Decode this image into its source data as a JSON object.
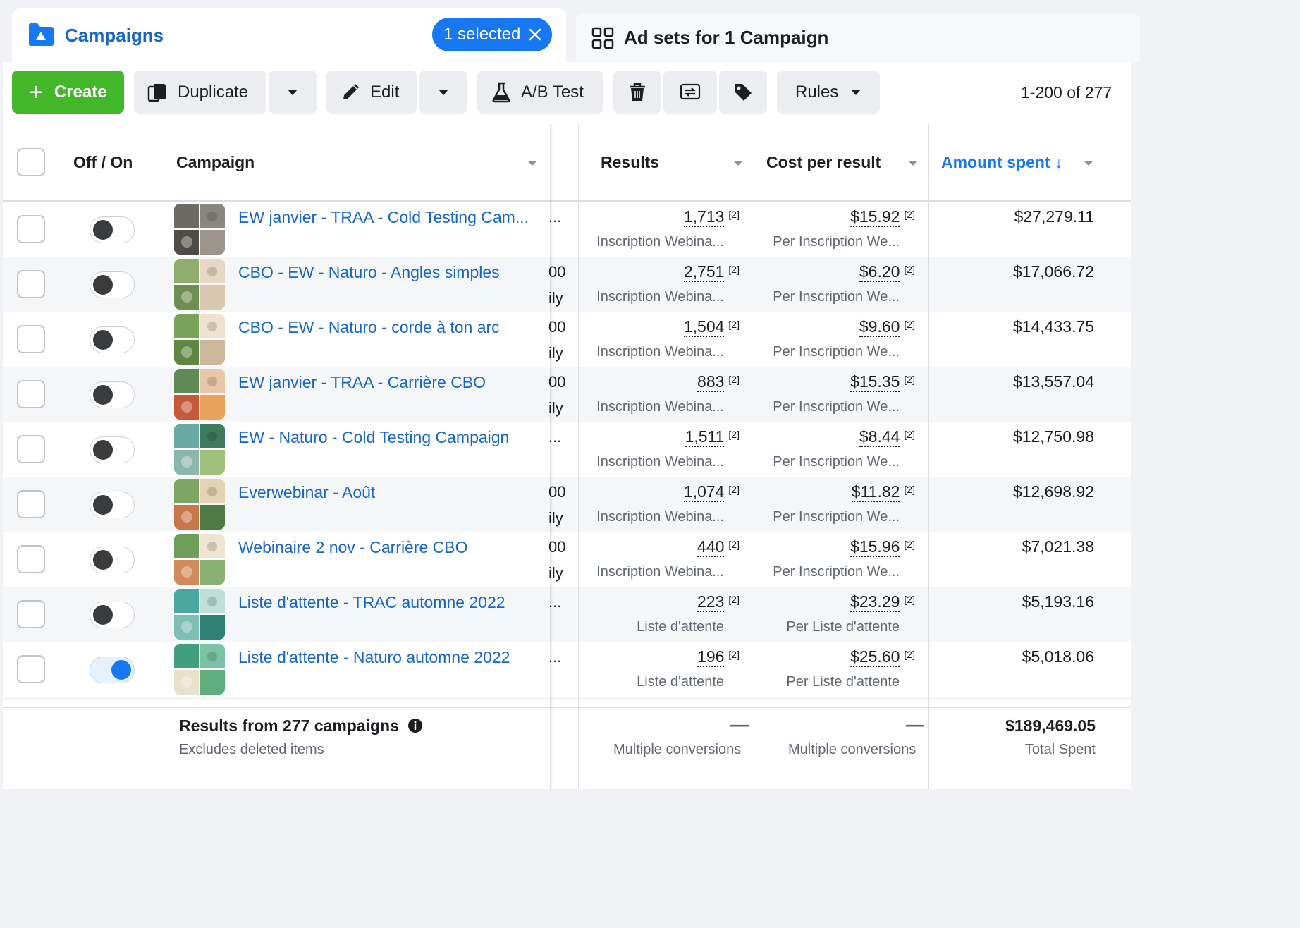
{
  "tabs": {
    "campaigns_label": "Campaigns",
    "selected_label": "1 selected",
    "adsets_label": "Ad sets for 1 Campaign"
  },
  "toolbar": {
    "create_label": "Create",
    "duplicate_label": "Duplicate",
    "edit_label": "Edit",
    "ab_test_label": "A/B Test",
    "rules_label": "Rules",
    "pager_text": "1-200 of 277"
  },
  "columns": {
    "off_on": "Off / On",
    "campaign": "Campaign",
    "results": "Results",
    "cost_per_result": "Cost per result",
    "amount_spent": "Amount spent ↓"
  },
  "rows": [
    {
      "name": "EW janvier - TRAA - Cold Testing Cam...",
      "frag1": "...",
      "frag2": "",
      "results": "1,713",
      "results_type": "Inscription Webina...",
      "cost": "$15.92",
      "cost_type": "Per Inscription We...",
      "amount": "$27,279.11",
      "on": false
    },
    {
      "name": "CBO - EW - Naturo - Angles simples",
      "frag1": "00",
      "frag2": "ily",
      "results": "2,751",
      "results_type": "Inscription Webina...",
      "cost": "$6.20",
      "cost_type": "Per Inscription We...",
      "amount": "$17,066.72",
      "on": false
    },
    {
      "name": "CBO - EW - Naturo - corde à ton arc",
      "frag1": "00",
      "frag2": "ily",
      "results": "1,504",
      "results_type": "Inscription Webina...",
      "cost": "$9.60",
      "cost_type": "Per Inscription We...",
      "amount": "$14,433.75",
      "on": false
    },
    {
      "name": "EW janvier - TRAA - Carrière CBO",
      "frag1": "00",
      "frag2": "ily",
      "results": "883",
      "results_type": "Inscription Webina...",
      "cost": "$15.35",
      "cost_type": "Per Inscription We...",
      "amount": "$13,557.04",
      "on": false
    },
    {
      "name": "EW - Naturo - Cold Testing Campaign",
      "frag1": "...",
      "frag2": "",
      "results": "1,511",
      "results_type": "Inscription Webina...",
      "cost": "$8.44",
      "cost_type": "Per Inscription We...",
      "amount": "$12,750.98",
      "on": false
    },
    {
      "name": "Everwebinar - Août",
      "frag1": "00",
      "frag2": "ily",
      "results": "1,074",
      "results_type": "Inscription Webina...",
      "cost": "$11.82",
      "cost_type": "Per Inscription We...",
      "amount": "$12,698.92",
      "on": false
    },
    {
      "name": "Webinaire 2 nov - Carrière CBO",
      "frag1": "00",
      "frag2": "ily",
      "results": "440",
      "results_type": "Inscription Webina...",
      "cost": "$15.96",
      "cost_type": "Per Inscription We...",
      "amount": "$7,021.38",
      "on": false
    },
    {
      "name": "Liste d'attente - TRAC automne 2022",
      "frag1": "...",
      "frag2": "",
      "results": "223",
      "results_type": "Liste d'attente",
      "cost": "$23.29",
      "cost_type": "Per Liste d'attente",
      "amount": "$5,193.16",
      "on": false
    },
    {
      "name": "Liste d'attente - Naturo automne 2022",
      "frag1": "...",
      "frag2": "",
      "results": "196",
      "results_type": "Liste d'attente",
      "cost": "$25.60",
      "cost_type": "Per Liste d'attente",
      "amount": "$5,018.06",
      "on": true
    }
  ],
  "result_superscript": "[2]",
  "footer": {
    "title": "Results from 277 campaigns",
    "subtitle": "Excludes deleted items",
    "results_dash": "—",
    "results_sub": "Multiple conversions",
    "cost_dash": "—",
    "cost_sub": "Multiple conversions",
    "total": "$189,469.05",
    "total_sub": "Total Spent"
  },
  "colors": {
    "brand_blue": "#1877f2",
    "link_blue": "#1665c7",
    "create_green": "#42b72a"
  }
}
